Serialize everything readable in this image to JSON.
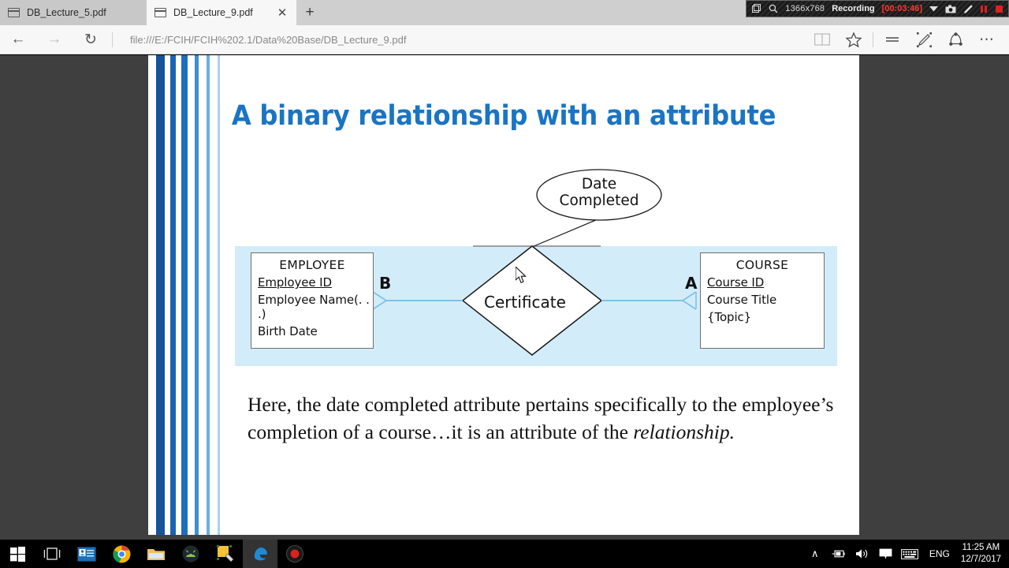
{
  "browser": {
    "tabs": [
      {
        "title": "DB_Lecture_5.pdf",
        "active": false,
        "icon": "pdf-document-icon"
      },
      {
        "title": "DB_Lecture_9.pdf",
        "active": true,
        "icon": "pdf-document-icon",
        "close": "✕"
      }
    ],
    "new_tab_label": "+",
    "nav": {
      "back": "←",
      "forward": "→",
      "refresh": "↻",
      "url": "file:///E:/FCIH/FCIH%202.1/Data%20Base/DB_Lecture_9.pdf"
    },
    "toolbar_icons": [
      "reading-view-icon",
      "favorites-star-icon",
      "hub-icon",
      "web-note-icon",
      "share-icon",
      "more-icon"
    ],
    "more_label": "⋯"
  },
  "recorder": {
    "resolution": "1366x768",
    "status": "Recording",
    "elapsed": "[00:03:46]",
    "icons": [
      "window-icon",
      "magnifier-icon",
      "dropdown-icon",
      "camera-icon",
      "pencil-icon",
      "pause-icon",
      "stop-icon"
    ]
  },
  "slide": {
    "title": "A binary relationship with an attribute",
    "attribute_ellipse": {
      "line1": "Date",
      "line2": "Completed"
    },
    "relationship": {
      "label": "Certificate",
      "shape": "diamond"
    },
    "entities": [
      {
        "name": "EMPLOYEE",
        "attributes": [
          {
            "text": "Employee ID",
            "key": true
          },
          {
            "text": "Employee Name(. . .)",
            "key": false
          },
          {
            "text": "Birth Date",
            "key": false
          }
        ],
        "cardinality_label": "B"
      },
      {
        "name": "COURSE",
        "attributes": [
          {
            "text": "Course ID",
            "key": true
          },
          {
            "text": "Course Title",
            "key": false
          },
          {
            "text": "{Topic}",
            "key": false
          }
        ],
        "cardinality_label": "A"
      }
    ],
    "body_text_1": "Here, the date completed attribute pertains specifically to the employee’s completion of a course…it is an attribute of the ",
    "body_text_italic": "relationship.",
    "colors": {
      "title_blue": "#1a74c4",
      "band_blue": "#d3ecfa",
      "connector_blue": "#7cc3e8"
    }
  },
  "taskbar": {
    "items": [
      "start-button",
      "task-view-button",
      "mail-app-icon",
      "chrome-icon",
      "file-explorer-icon",
      "android-studio-icon",
      "capture-tool-icon",
      "edge-icon",
      "recorder-icon"
    ],
    "tray": {
      "show_hidden": "∧",
      "icons": [
        "battery-icon",
        "volume-icon",
        "action-center-icon",
        "keyboard-icon"
      ],
      "language": "ENG",
      "time": "11:25 AM",
      "date": "12/7/2017"
    }
  }
}
